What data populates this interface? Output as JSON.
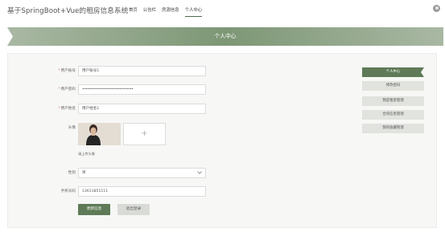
{
  "header": {
    "site_title": "基于SpringBoot+Vue的租房信息系统",
    "nav": [
      {
        "label": "首页",
        "active": false
      },
      {
        "label": "公告栏",
        "active": false
      },
      {
        "label": "房源信息",
        "active": false
      },
      {
        "label": "个人中心",
        "active": true
      }
    ],
    "avatar_icon": "user-avatar-icon"
  },
  "banner": {
    "title": "个人中心",
    "color": "#6f8a67"
  },
  "form": {
    "username": {
      "label": "用户账号",
      "required": true,
      "value": "用户账号1"
    },
    "password": {
      "label": "用户密码",
      "required": true,
      "value": "••••••••••••••••••••••••••••••"
    },
    "name": {
      "label": "用户姓名",
      "required": true,
      "value": "用户姓名1"
    },
    "avatar": {
      "label": "头像",
      "upload_icon": "plus-icon",
      "upload_plus": "+",
      "hint": "请上传头像"
    },
    "gender": {
      "label": "性别",
      "value": "男",
      "icon": "chevron-down-icon"
    },
    "phone": {
      "label": "手机号码",
      "value": "13611851111"
    },
    "buttons": {
      "update": "更新信息",
      "logout": "退出登录"
    }
  },
  "side_menu": [
    {
      "label": "个人中心",
      "active": true
    },
    {
      "label": "修改密码",
      "active": false
    },
    {
      "label": "我是租客管理",
      "active": false
    },
    {
      "label": "合同信息管理",
      "active": false
    },
    {
      "label": "我的收藏管理",
      "active": false
    }
  ],
  "colors": {
    "accent": "#5f7a57",
    "accent_light": "#d9dcd6",
    "required": "#e46b6b"
  }
}
